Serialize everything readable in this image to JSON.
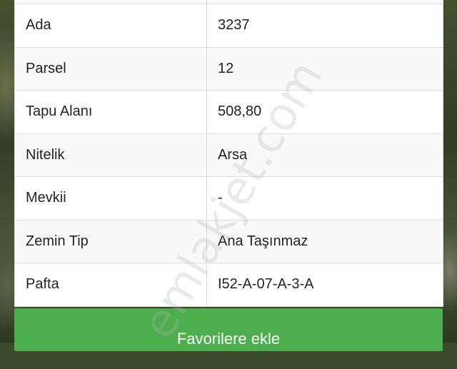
{
  "property_details": [
    {
      "label": "Ada",
      "value": "3237"
    },
    {
      "label": "Parsel",
      "value": "12"
    },
    {
      "label": "Tapu Alanı",
      "value": "508,80"
    },
    {
      "label": "Nitelik",
      "value": "Arsa"
    },
    {
      "label": "Mevkii",
      "value": "-"
    },
    {
      "label": "Zemin Tip",
      "value": "Ana Taşınmaz"
    },
    {
      "label": "Pafta",
      "value": "I52-A-07-A-3-A"
    }
  ],
  "actions": {
    "add_favorite_label": "Favorilere ekle"
  },
  "watermark": "emlakjet.com",
  "colors": {
    "button_green": "#4cae4c",
    "row_alt": "#f9f9f9",
    "border": "#dedede"
  }
}
